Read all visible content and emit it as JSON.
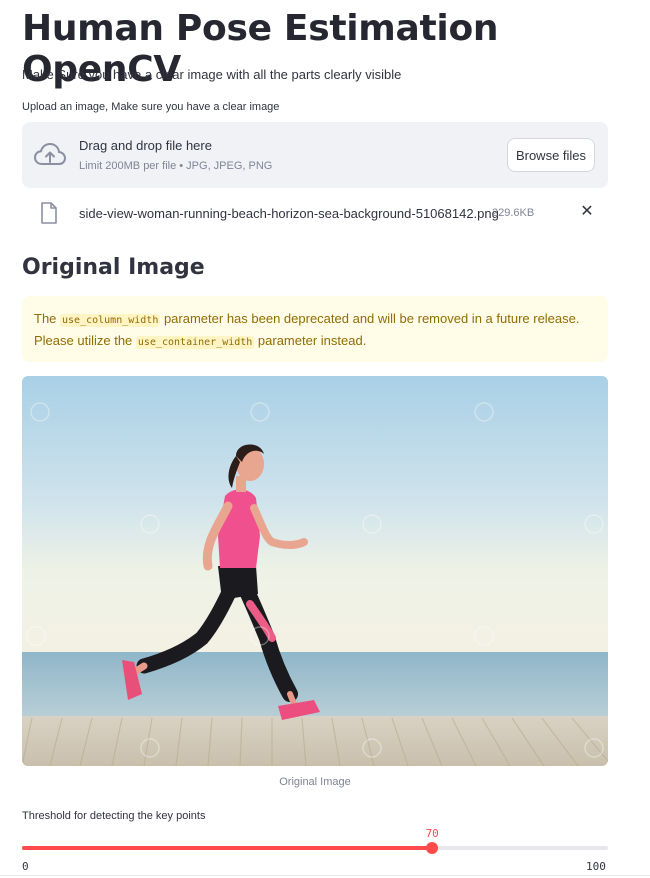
{
  "header": {
    "title": "Human Pose Estimation OpenCV",
    "subtitle": "Make Sure you have a clear image with all the parts clearly visible"
  },
  "uploader": {
    "label": "Upload an image, Make sure you have a clear image",
    "drop_text": "Drag and drop file here",
    "limit_text": "Limit 200MB per file • JPG, JPEG, PNG",
    "browse_label": "Browse files",
    "file": {
      "name": "side-view-woman-running-beach-horizon-sea-background-51068142.png",
      "size": "229.6KB"
    }
  },
  "section": {
    "heading": "Original Image"
  },
  "warning": {
    "part1": "The ",
    "code1": "use_column_width",
    "part2": " parameter has been deprecated and will be removed in a future release. Please utilize the ",
    "code2": "use_container_width",
    "part3": " parameter instead."
  },
  "image": {
    "caption": "Original Image"
  },
  "slider": {
    "label": "Threshold for detecting the key points",
    "value": 70,
    "min": 0,
    "max": 100,
    "min_label": "0",
    "max_label": "100",
    "value_label": "70"
  },
  "colors": {
    "accent": "#ff4b4b",
    "warning_bg": "#fffce7",
    "warning_text": "#926c05",
    "dropzone_bg": "#f0f2f6"
  },
  "icons": {
    "upload": "cloud-upload-icon",
    "file": "file-icon",
    "close": "close-icon"
  }
}
